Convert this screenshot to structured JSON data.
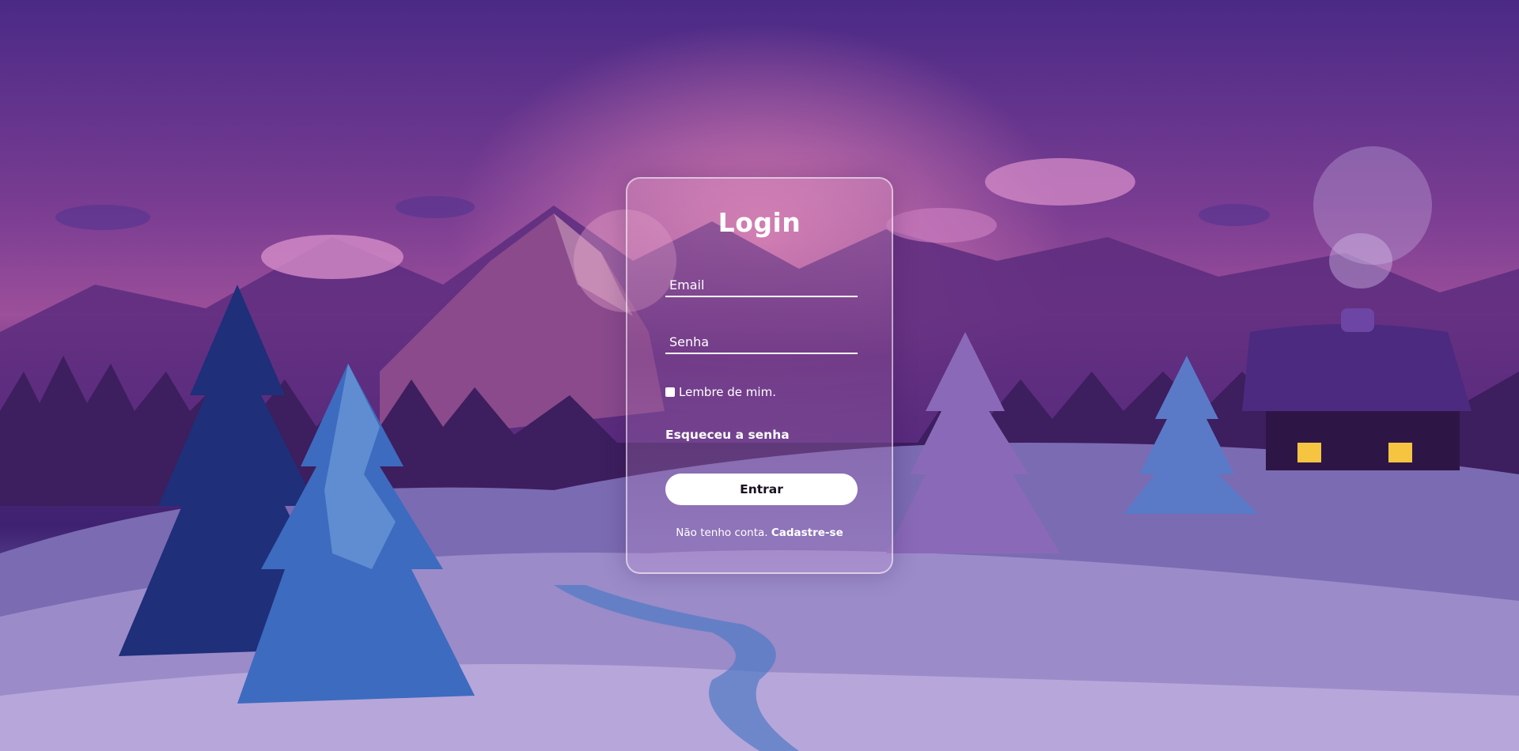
{
  "login": {
    "title": "Login",
    "email_placeholder": "Email",
    "password_placeholder": "Senha",
    "remember_label": "Lembre de mim.",
    "forgot_label": "Esqueceu a senha",
    "submit_label": "Entrar",
    "no_account_text": "Não tenho conta.",
    "signup_label": "Cadastre-se"
  },
  "icons": {
    "checkbox": "checkbox-icon"
  },
  "colors": {
    "sky_top": "#4a2a86",
    "glow": "#d57ab0",
    "snow": "#a493cf",
    "button_bg": "#ffffff",
    "text": "#ffffff"
  }
}
